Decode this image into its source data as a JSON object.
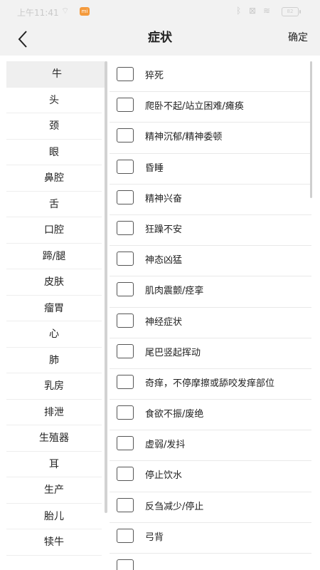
{
  "status_bar": {
    "time": "上午11:41",
    "battery": "82"
  },
  "header": {
    "title": "症状",
    "confirm_label": "确定"
  },
  "categories": [
    {
      "label": "牛",
      "active": true
    },
    {
      "label": "头"
    },
    {
      "label": "颈"
    },
    {
      "label": "眼"
    },
    {
      "label": "鼻腔"
    },
    {
      "label": "舌"
    },
    {
      "label": "口腔"
    },
    {
      "label": "蹄/腿"
    },
    {
      "label": "皮肤"
    },
    {
      "label": "瘤胃"
    },
    {
      "label": "心"
    },
    {
      "label": "肺"
    },
    {
      "label": "乳房"
    },
    {
      "label": "排泄"
    },
    {
      "label": "生殖器"
    },
    {
      "label": "耳"
    },
    {
      "label": "生产"
    },
    {
      "label": "胎儿"
    },
    {
      "label": "犊牛"
    }
  ],
  "symptoms": [
    {
      "label": "猝死",
      "checked": false
    },
    {
      "label": "爬卧不起/站立困难/瘫痪",
      "checked": false
    },
    {
      "label": "精神沉郁/精神委顿",
      "checked": false
    },
    {
      "label": "昏睡",
      "checked": false
    },
    {
      "label": "精神兴奋",
      "checked": false
    },
    {
      "label": "狂躁不安",
      "checked": false
    },
    {
      "label": "神态凶猛",
      "checked": false
    },
    {
      "label": "肌肉震颤/痉挛",
      "checked": false
    },
    {
      "label": "神经症状",
      "checked": false
    },
    {
      "label": "尾巴竖起挥动",
      "checked": false
    },
    {
      "label": "奇痒，不停摩擦或舔咬发痒部位",
      "checked": false
    },
    {
      "label": "食欲不振/废绝",
      "checked": false
    },
    {
      "label": "虚弱/发抖",
      "checked": false
    },
    {
      "label": "停止饮水",
      "checked": false
    },
    {
      "label": "反刍减少/停止",
      "checked": false
    },
    {
      "label": "弓背",
      "checked": false
    },
    {
      "label": "",
      "checked": false
    }
  ],
  "colors": {
    "header_bg": "#f2f2f2",
    "active_category_bg": "#efefef",
    "checkbox_border": "#555555"
  }
}
